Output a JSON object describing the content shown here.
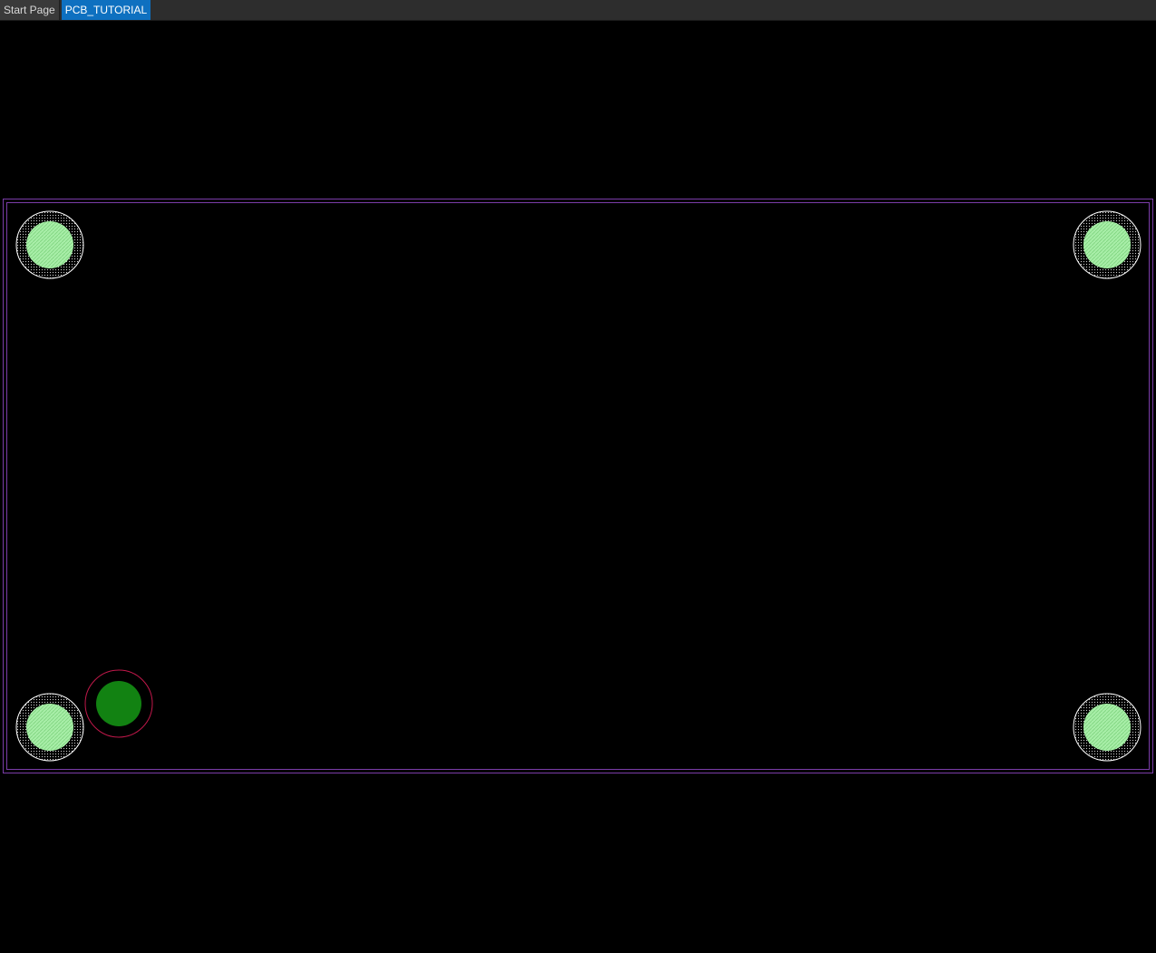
{
  "tabs": [
    {
      "label": "Start Page",
      "active": false
    },
    {
      "label": "PCB_TUTORIAL",
      "active": true
    }
  ],
  "colors": {
    "background": "#000000",
    "tab_active": "#0e70c0",
    "board_outline": "#7a3ca8",
    "mounting_hole_pad": "#a8eea8",
    "via_fill": "#128212",
    "via_ring": "#c0184a",
    "keepout_ring": "#ffffff"
  },
  "board": {
    "mounting_holes": [
      "mounting-hole-top-left",
      "mounting-hole-top-right",
      "mounting-hole-bottom-left",
      "mounting-hole-bottom-right"
    ],
    "vias": [
      "via-bottom-left"
    ]
  }
}
